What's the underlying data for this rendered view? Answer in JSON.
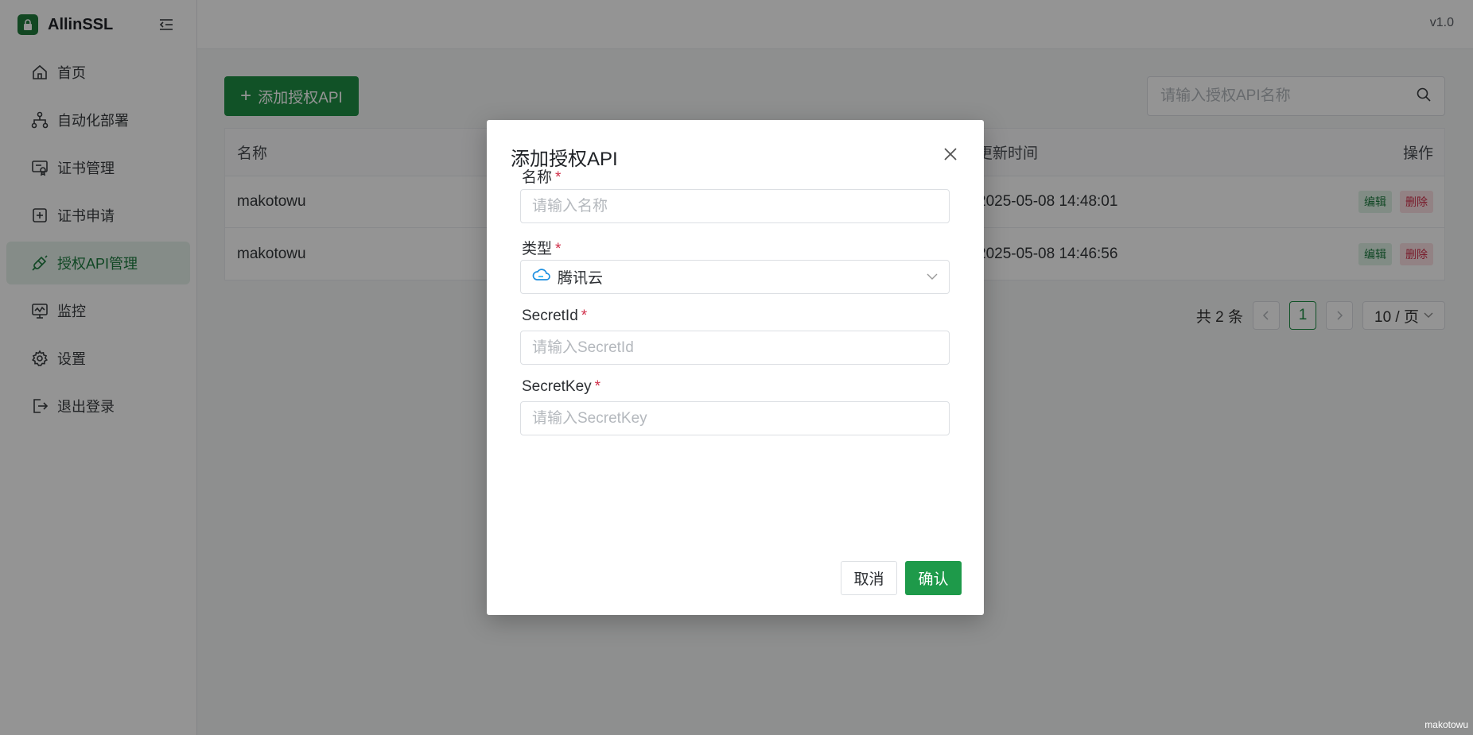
{
  "app": {
    "name": "AllinSSL",
    "version": "v1.0"
  },
  "sidebar": {
    "items": [
      {
        "label": "首页",
        "icon": "home-icon"
      },
      {
        "label": "自动化部署",
        "icon": "workflow-icon"
      },
      {
        "label": "证书管理",
        "icon": "certificate-icon"
      },
      {
        "label": "证书申请",
        "icon": "plus-square-icon"
      },
      {
        "label": "授权API管理",
        "icon": "api-plug-icon",
        "active": true
      },
      {
        "label": "监控",
        "icon": "monitor-icon"
      },
      {
        "label": "设置",
        "icon": "gear-icon"
      },
      {
        "label": "退出登录",
        "icon": "logout-icon"
      }
    ]
  },
  "toolbar": {
    "add_label": "添加授权API",
    "search_placeholder": "请输入授权API名称"
  },
  "table": {
    "headers": {
      "name": "名称",
      "time": "更新时间",
      "op": "操作"
    },
    "rows": [
      {
        "name": "makotowu",
        "time": "2025-05-08 14:48:01"
      },
      {
        "name": "makotowu",
        "time": "2025-05-08 14:46:56"
      }
    ],
    "edit_label": "编辑",
    "delete_label": "删除"
  },
  "pagination": {
    "total": "共 2 条",
    "current": "1",
    "page_size": "10 / 页"
  },
  "modal": {
    "title": "添加授权API",
    "fields": {
      "name": {
        "label": "名称",
        "placeholder": "请输入名称"
      },
      "type": {
        "label": "类型",
        "value": "腾讯云"
      },
      "secret_id": {
        "label": "SecretId",
        "placeholder": "请输入SecretId"
      },
      "secret_key": {
        "label": "SecretKey",
        "placeholder": "请输入SecretKey"
      }
    },
    "required_mark": "*",
    "cancel_label": "取消",
    "confirm_label": "确认"
  },
  "watermark": "makotowu",
  "colors": {
    "primary": "#1e8d44",
    "danger": "#d0304a",
    "overlay": "rgba(0,0,0,0.42)"
  }
}
